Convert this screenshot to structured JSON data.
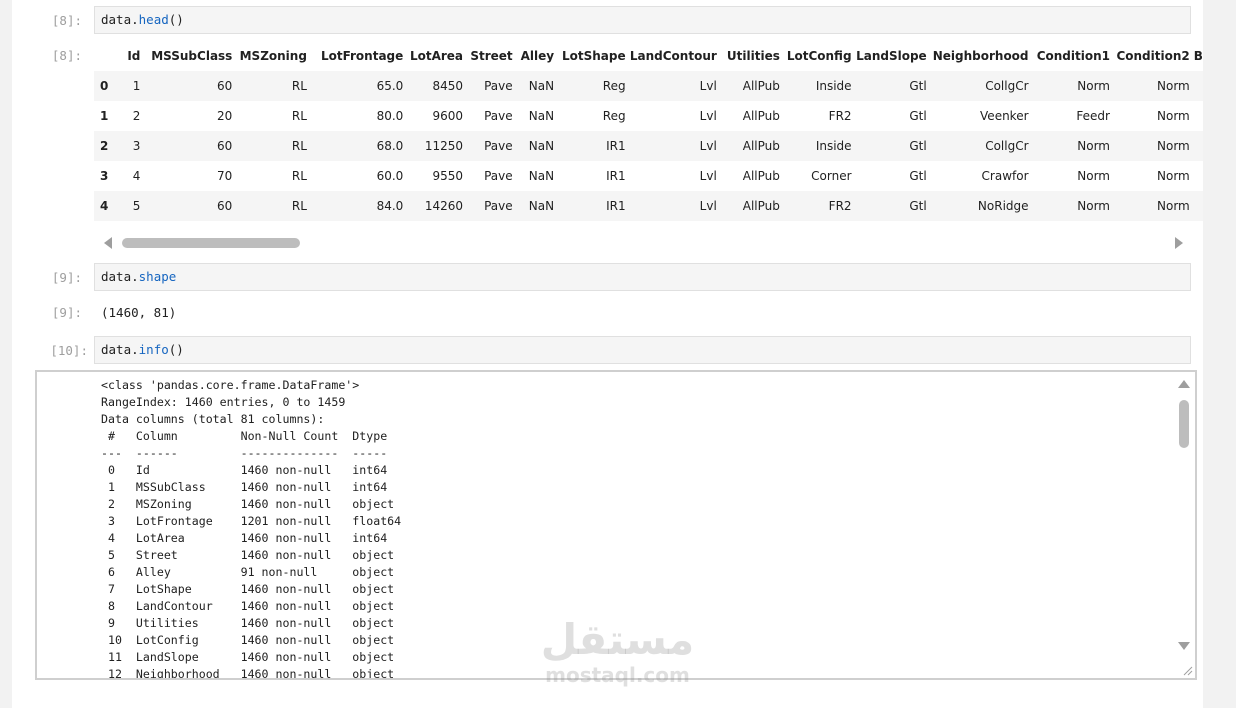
{
  "cells": [
    {
      "prompt": "[8]:",
      "code_obj": "data.",
      "code_fn": "head",
      "code_args": "()",
      "out_prompt": "[8]:"
    },
    {
      "prompt": "[9]:",
      "code_obj": "data.",
      "code_fn": "shape",
      "code_args": "",
      "out_prompt": "[9]:",
      "output": "(1460, 81)"
    },
    {
      "prompt": "[10]:",
      "code_obj": "data.",
      "code_fn": "info",
      "code_args": "()"
    }
  ],
  "dataframe": {
    "columns": [
      "",
      "Id",
      "MSSubClass",
      "MSZoning",
      "LotFrontage",
      "LotArea",
      "Street",
      "Alley",
      "LotShape",
      "LandContour",
      "Utilities",
      "LotConfig",
      "LandSlope",
      "Neighborhood",
      "Condition1",
      "Condition2",
      "B"
    ],
    "rows": [
      [
        "0",
        "1",
        "60",
        "RL",
        "65.0",
        "8450",
        "Pave",
        "NaN",
        "Reg",
        "Lvl",
        "AllPub",
        "Inside",
        "Gtl",
        "CollgCr",
        "Norm",
        "Norm"
      ],
      [
        "1",
        "2",
        "20",
        "RL",
        "80.0",
        "9600",
        "Pave",
        "NaN",
        "Reg",
        "Lvl",
        "AllPub",
        "FR2",
        "Gtl",
        "Veenker",
        "Feedr",
        "Norm"
      ],
      [
        "2",
        "3",
        "60",
        "RL",
        "68.0",
        "11250",
        "Pave",
        "NaN",
        "IR1",
        "Lvl",
        "AllPub",
        "Inside",
        "Gtl",
        "CollgCr",
        "Norm",
        "Norm"
      ],
      [
        "3",
        "4",
        "70",
        "RL",
        "60.0",
        "9550",
        "Pave",
        "NaN",
        "IR1",
        "Lvl",
        "AllPub",
        "Corner",
        "Gtl",
        "Crawfor",
        "Norm",
        "Norm"
      ],
      [
        "4",
        "5",
        "60",
        "RL",
        "84.0",
        "14260",
        "Pave",
        "NaN",
        "IR1",
        "Lvl",
        "AllPub",
        "FR2",
        "Gtl",
        "NoRidge",
        "Norm",
        "Norm"
      ]
    ]
  },
  "info_output": [
    "<class 'pandas.core.frame.DataFrame'>",
    "RangeIndex: 1460 entries, 0 to 1459",
    "Data columns (total 81 columns):",
    " #   Column         Non-Null Count  Dtype  ",
    "---  ------         --------------  -----  ",
    " 0   Id             1460 non-null   int64  ",
    " 1   MSSubClass     1460 non-null   int64  ",
    " 2   MSZoning       1460 non-null   object ",
    " 3   LotFrontage    1201 non-null   float64",
    " 4   LotArea        1460 non-null   int64  ",
    " 5   Street         1460 non-null   object ",
    " 6   Alley          91 non-null     object ",
    " 7   LotShape       1460 non-null   object ",
    " 8   LandContour    1460 non-null   object ",
    " 9   Utilities      1460 non-null   object ",
    " 10  LotConfig      1460 non-null   object ",
    " 11  LandSlope      1460 non-null   object ",
    " 12  Neighborhood   1460 non-null   object "
  ],
  "watermark": {
    "arabic": "مستقل",
    "latin": "mostaql.com"
  },
  "colors": {
    "function": "#1565c0",
    "prompt": "#9e9e9e",
    "code_bg": "#f5f5f5"
  }
}
